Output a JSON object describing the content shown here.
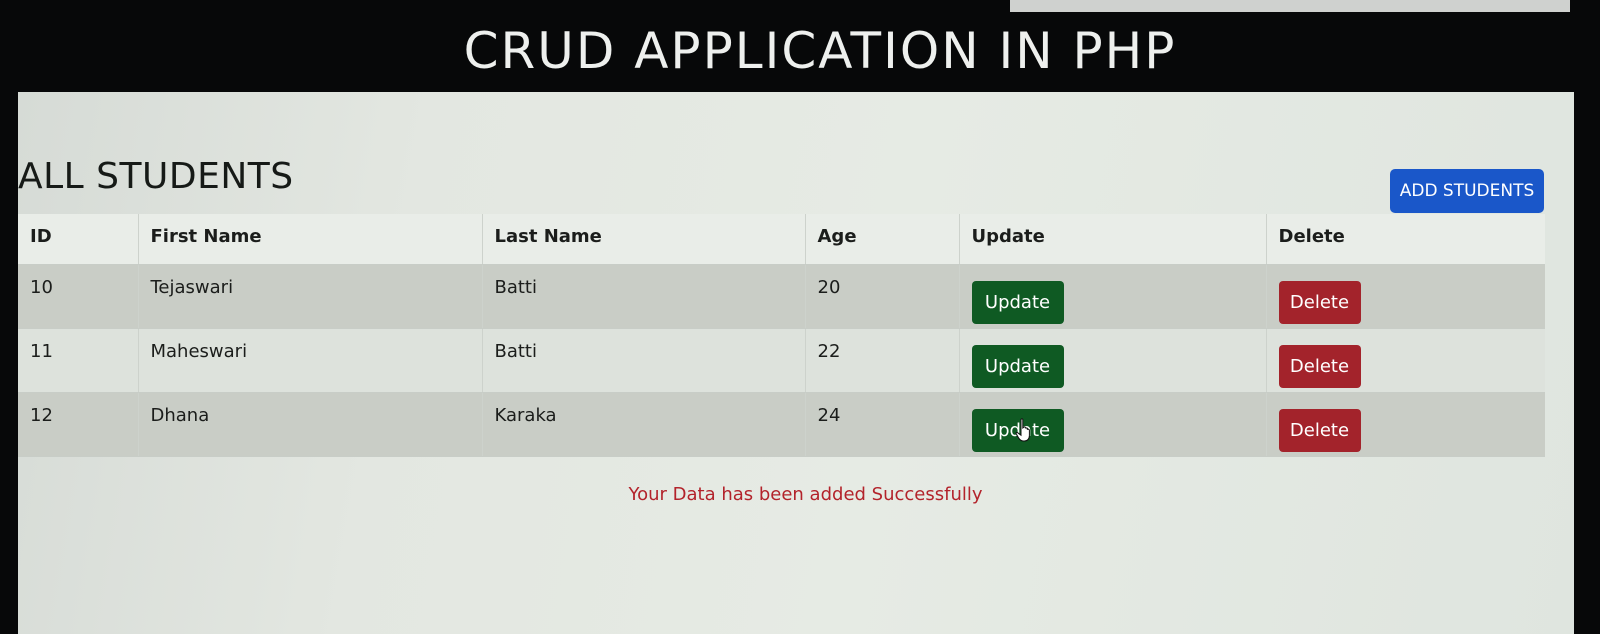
{
  "app": {
    "title": "CRUD APPLICATION IN PHP"
  },
  "section": {
    "title": "ALL STUDENTS",
    "add_button_label": "ADD STUDENTS"
  },
  "table": {
    "headers": [
      "ID",
      "First Name",
      "Last Name",
      "Age",
      "Update",
      "Delete"
    ],
    "rows": [
      {
        "id": "10",
        "first_name": "Tejaswari",
        "last_name": "Batti",
        "age": "20",
        "update_label": "Update",
        "delete_label": "Delete"
      },
      {
        "id": "11",
        "first_name": "Maheswari",
        "last_name": "Batti",
        "age": "22",
        "update_label": "Update",
        "delete_label": "Delete"
      },
      {
        "id": "12",
        "first_name": "Dhana",
        "last_name": "Karaka",
        "age": "24",
        "update_label": "Update",
        "delete_label": "Delete"
      }
    ]
  },
  "status_message": "Your Data has been added Successfully",
  "colors": {
    "add_button": "#1a57c9",
    "update_button": "#0f5a23",
    "delete_button": "#a3232b",
    "message": "#b3232b"
  },
  "icons": {
    "cursor": "hand-pointer-icon"
  }
}
